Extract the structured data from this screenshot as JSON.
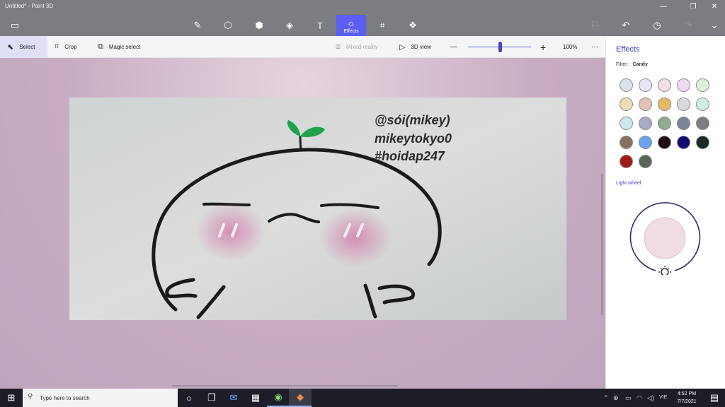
{
  "app": {
    "title": "Untitled* - Paint 3D"
  },
  "window_controls": {
    "minimize": "—",
    "maximize": "❐",
    "close": "✕"
  },
  "menu_icon": "folder-icon",
  "main_tools": [
    {
      "id": "brushes",
      "icon": "brush-icon",
      "glyph": "✎"
    },
    {
      "id": "2d-shapes",
      "icon": "shapes-2d-icon",
      "glyph": "⬡"
    },
    {
      "id": "3d-shapes",
      "icon": "cube-icon",
      "glyph": "⬢"
    },
    {
      "id": "stickers",
      "icon": "sticker-icon",
      "glyph": "◈"
    },
    {
      "id": "text",
      "icon": "text-icon",
      "glyph": "T"
    },
    {
      "id": "effects",
      "icon": "effects-sun-icon",
      "glyph": "☼",
      "label": "Effects",
      "active": true
    },
    {
      "id": "canvas",
      "icon": "canvas-crop-icon",
      "glyph": "⌗"
    },
    {
      "id": "3d-library",
      "icon": "library-3d-icon",
      "glyph": "❖"
    }
  ],
  "right_tools": [
    {
      "id": "paste",
      "icon": "paste-icon",
      "glyph": "⎘",
      "enabled": false
    },
    {
      "id": "undo",
      "icon": "undo-icon",
      "glyph": "↶",
      "enabled": true
    },
    {
      "id": "history",
      "icon": "history-icon",
      "glyph": "◷",
      "enabled": true
    },
    {
      "id": "redo",
      "icon": "redo-icon",
      "glyph": "↷",
      "enabled": false
    },
    {
      "id": "expand",
      "icon": "chevron-down-icon",
      "glyph": "⌄",
      "enabled": true
    }
  ],
  "subbar": {
    "select": "Select",
    "crop": "Crop",
    "magic_select": "Magic select",
    "mixed_reality": "Mixed reality",
    "view_3d": "3D view",
    "zoom_out": "—",
    "zoom_in": "+",
    "zoom_level": "100%",
    "zoom_fraction": 0.5,
    "more": "···"
  },
  "canvas": {
    "watermark": [
      "@sói(mikey)",
      "mikeytokyo0",
      "#hoidap247"
    ]
  },
  "panel": {
    "title": "Effects",
    "filter_label": "Filter :",
    "filter_value": "Candy",
    "swatches": [
      "#dce0ea",
      "#e6e6f5",
      "#f2dde8",
      "#eadcec",
      "#dff1dc",
      "#efdcb6",
      "#e5c3b4",
      "#e7b964",
      "#d7d9dd",
      "#cdeee6",
      "#cbe8ee",
      "#a9a9c3",
      "#90ac8e",
      "#7a8597",
      "#7b7f82",
      "#8a715f",
      "#6aa2ef",
      "#1f0a16",
      "#0f0970",
      "#1c2a24",
      "#a11c14",
      "#5a6658"
    ],
    "light_wheel_label": "Light wheel",
    "light_color": "#f0dce3"
  },
  "taskbar": {
    "search_placeholder": "Type here to search",
    "time": "4:52 PM",
    "date": "7/7/2021",
    "lang": "VIE"
  }
}
